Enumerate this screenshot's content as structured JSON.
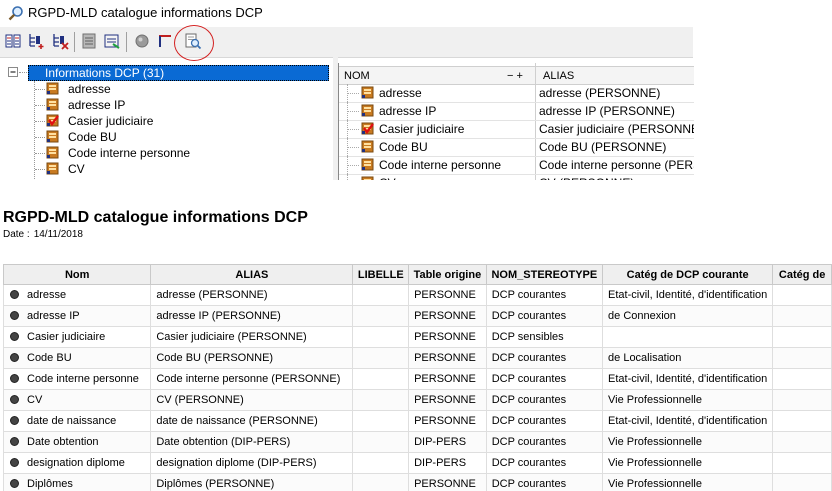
{
  "window": {
    "title": "RGPD-MLD catalogue informations DCP"
  },
  "toolbar": {
    "buttons": [
      {
        "name": "list-view-icon"
      },
      {
        "name": "tree-add-icon"
      },
      {
        "name": "tree-delete-icon"
      },
      {
        "name": "properties-icon"
      },
      {
        "name": "export-icon"
      },
      {
        "name": "disabled-icon"
      },
      {
        "name": "filter-icon"
      },
      {
        "name": "print-preview-icon"
      }
    ]
  },
  "tree": {
    "root": "Informations DCP (31)",
    "items": [
      {
        "label": "adresse",
        "icon": "attribute-icon"
      },
      {
        "label": "adresse IP",
        "icon": "attribute-icon"
      },
      {
        "label": "Casier judiciaire",
        "icon": "sensitive-attribute-icon"
      },
      {
        "label": "Code BU",
        "icon": "attribute-icon"
      },
      {
        "label": "Code interne personne",
        "icon": "attribute-icon"
      },
      {
        "label": "CV",
        "icon": "attribute-icon"
      }
    ]
  },
  "grid": {
    "col_nom": "NOM",
    "col_ctrl": "− +",
    "col_alias": "ALIAS",
    "rows": [
      {
        "nom": "adresse",
        "alias": "adresse (PERSONNE)",
        "sensitive": false
      },
      {
        "nom": "adresse IP",
        "alias": "adresse IP (PERSONNE)",
        "sensitive": false
      },
      {
        "nom": "Casier judiciaire",
        "alias": "Casier judiciaire (PERSONNE)",
        "sensitive": true
      },
      {
        "nom": "Code BU",
        "alias": "Code BU (PERSONNE)",
        "sensitive": false
      },
      {
        "nom": "Code interne personne",
        "alias": "Code interne personne (PERSONNE)",
        "sensitive": false
      },
      {
        "nom": "CV",
        "alias": "CV (PERSONNE)",
        "sensitive": false
      }
    ]
  },
  "report": {
    "title": "RGPD-MLD catalogue informations DCP",
    "date_label": "Date :",
    "date_value": "14/11/2018",
    "columns": [
      "Nom",
      "ALIAS",
      "LIBELLE",
      "Table origine",
      "NOM_STEREOTYPE",
      "Catég de DCP courante",
      "Catég de"
    ],
    "rows": [
      [
        "adresse",
        "adresse (PERSONNE)",
        "",
        "PERSONNE",
        "DCP courantes",
        "Etat-civil, Identité, d'identification",
        ""
      ],
      [
        "adresse IP",
        "adresse IP (PERSONNE)",
        "",
        "PERSONNE",
        "DCP courantes",
        "de Connexion",
        ""
      ],
      [
        "Casier judiciaire",
        "Casier judiciaire (PERSONNE)",
        "",
        "PERSONNE",
        "DCP sensibles",
        "",
        ""
      ],
      [
        "Code BU",
        "Code BU (PERSONNE)",
        "",
        "PERSONNE",
        "DCP courantes",
        "de Localisation",
        ""
      ],
      [
        "Code interne personne",
        "Code interne personne (PERSONNE)",
        "",
        "PERSONNE",
        "DCP courantes",
        "Etat-civil, Identité, d'identification",
        ""
      ],
      [
        "CV",
        "CV (PERSONNE)",
        "",
        "PERSONNE",
        "DCP courantes",
        "Vie Professionnelle",
        ""
      ],
      [
        "date de naissance",
        "date de naissance (PERSONNE)",
        "",
        "PERSONNE",
        "DCP courantes",
        "Etat-civil, Identité, d'identification",
        ""
      ],
      [
        "Date obtention",
        "Date obtention (DIP-PERS)",
        "",
        "DIP-PERS",
        "DCP courantes",
        "Vie Professionnelle",
        ""
      ],
      [
        "designation diplome",
        "designation diplome (DIP-PERS)",
        "",
        "DIP-PERS",
        "DCP courantes",
        "Vie Professionnelle",
        ""
      ],
      [
        "Diplômes",
        "Diplômes (PERSONNE)",
        "",
        "PERSONNE",
        "DCP courantes",
        "Vie Professionnelle",
        ""
      ]
    ]
  },
  "colors": {
    "selection": "#0a6ad4",
    "annotation_circle": "#d32020"
  }
}
